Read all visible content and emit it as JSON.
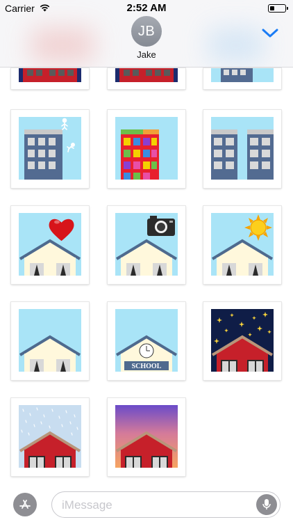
{
  "status_bar": {
    "carrier": "Carrier",
    "time": "2:52 AM",
    "wifi_icon": "wifi-icon",
    "battery_icon": "battery-icon",
    "battery_level": 0.2
  },
  "header": {
    "avatar_initials": "JB",
    "contact_name": "Jake",
    "collapse_icon": "chevron-down-icon",
    "accent_color": "#1a7cf5"
  },
  "stickers": [
    {
      "name": "sticker-building-red-night-partial"
    },
    {
      "name": "sticker-building-red-night-partial-2"
    },
    {
      "name": "sticker-building-blue-partial"
    },
    {
      "name": "sticker-skyscraper-jumper"
    },
    {
      "name": "sticker-colorful-building"
    },
    {
      "name": "sticker-twin-towers"
    },
    {
      "name": "sticker-house-heart"
    },
    {
      "name": "sticker-house-camera"
    },
    {
      "name": "sticker-house-sun"
    },
    {
      "name": "sticker-house-plain"
    },
    {
      "name": "sticker-school"
    },
    {
      "name": "sticker-house-night-stars"
    },
    {
      "name": "sticker-house-snow"
    },
    {
      "name": "sticker-house-sunset"
    }
  ],
  "school_sign": "SCHOOL",
  "compose": {
    "placeholder": "iMessage",
    "app_store_icon": "app-store-icon",
    "mic_icon": "microphone-icon"
  }
}
